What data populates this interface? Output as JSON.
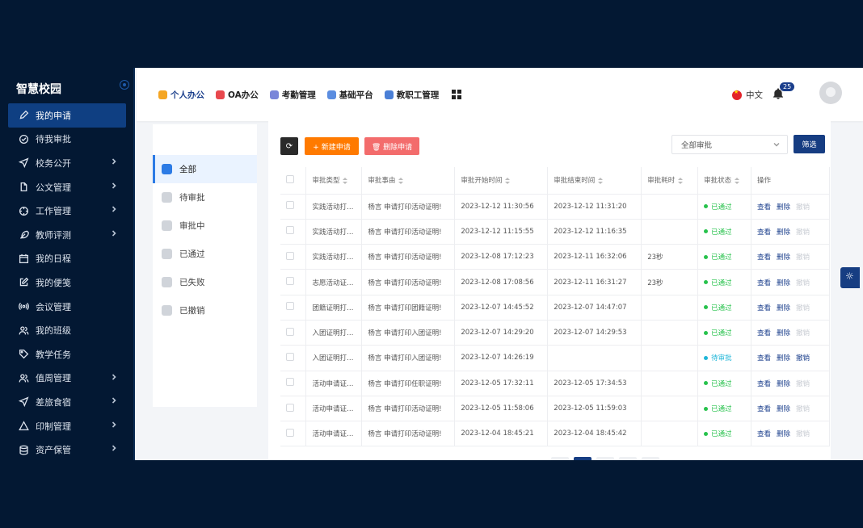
{
  "app": {
    "title": "智慧校园"
  },
  "sidebar": {
    "items": [
      {
        "label": "我的申请",
        "icon": "pen-icon",
        "active": true,
        "expandable": false
      },
      {
        "label": "待我审批",
        "icon": "check-circle-icon",
        "active": false,
        "expandable": false
      },
      {
        "label": "校务公开",
        "icon": "send-icon",
        "active": false,
        "expandable": true
      },
      {
        "label": "公文管理",
        "icon": "file-icon",
        "active": false,
        "expandable": true
      },
      {
        "label": "工作管理",
        "icon": "crosshair-icon",
        "active": false,
        "expandable": true
      },
      {
        "label": "教师评测",
        "icon": "feather-icon",
        "active": false,
        "expandable": true
      },
      {
        "label": "我的日程",
        "icon": "calendar-icon",
        "active": false,
        "expandable": false
      },
      {
        "label": "我的便笺",
        "icon": "edit-icon",
        "active": false,
        "expandable": false
      },
      {
        "label": "会议管理",
        "icon": "broadcast-icon",
        "active": false,
        "expandable": false
      },
      {
        "label": "我的班级",
        "icon": "users-icon",
        "active": false,
        "expandable": false
      },
      {
        "label": "教学任务",
        "icon": "tag-icon",
        "active": false,
        "expandable": false
      },
      {
        "label": "值周管理",
        "icon": "users-icon",
        "active": false,
        "expandable": true
      },
      {
        "label": "差旅食宿",
        "icon": "send-icon",
        "active": false,
        "expandable": true
      },
      {
        "label": "印制管理",
        "icon": "triangle-icon",
        "active": false,
        "expandable": true
      },
      {
        "label": "资产保管",
        "icon": "database-icon",
        "active": false,
        "expandable": true
      }
    ]
  },
  "topnav": {
    "items": [
      {
        "label": "个人办公",
        "color": "#f5a623",
        "active": true
      },
      {
        "label": "OA办公",
        "color": "#e8484d",
        "active": false
      },
      {
        "label": "考勤管理",
        "color": "#7a86d9",
        "active": false
      },
      {
        "label": "基础平台",
        "color": "#5b8de0",
        "active": false
      },
      {
        "label": "教职工管理",
        "color": "#4a7fd6",
        "active": false
      }
    ],
    "language": "中文",
    "notification_count": "25"
  },
  "status_tabs": {
    "items": [
      {
        "label": "全部",
        "active": true
      },
      {
        "label": "待审批",
        "active": false
      },
      {
        "label": "审批中",
        "active": false
      },
      {
        "label": "已通过",
        "active": false
      },
      {
        "label": "已失败",
        "active": false
      },
      {
        "label": "已撤销",
        "active": false
      }
    ]
  },
  "toolbar": {
    "new_label": "+ 新建申请",
    "delete_label": "🗑 删除申请",
    "filter_placeholder": "全部审批",
    "filter_button": "筛选"
  },
  "table": {
    "headers": [
      "审批类型",
      "审批事由",
      "审批开始时间",
      "审批结束时间",
      "审批耗时",
      "审批状态",
      "操作"
    ],
    "actions": {
      "view": "查看",
      "delete": "删除",
      "cancel": "撤销"
    },
    "rows": [
      {
        "type": "实践活动打…",
        "reason": "杨言 申请打印活动证明!",
        "start": "2023-12-12 11:30:56",
        "end": "2023-12-12 11:31:20",
        "duration": "",
        "status": "已通过",
        "status_color": "#27c24c",
        "cancel_enabled": false
      },
      {
        "type": "实践活动打…",
        "reason": "杨言 申请打印活动证明!",
        "start": "2023-12-12 11:15:55",
        "end": "2023-12-12 11:16:35",
        "duration": "",
        "status": "已通过",
        "status_color": "#27c24c",
        "cancel_enabled": false
      },
      {
        "type": "实践活动打…",
        "reason": "杨言 申请打印活动证明!",
        "start": "2023-12-08 17:12:23",
        "end": "2023-12-11 16:32:06",
        "duration": "23秒",
        "status": "已通过",
        "status_color": "#27c24c",
        "cancel_enabled": false
      },
      {
        "type": "志愿活动证…",
        "reason": "杨言 申请打印活动证明!",
        "start": "2023-12-08 17:08:56",
        "end": "2023-12-11 16:31:27",
        "duration": "23秒",
        "status": "已通过",
        "status_color": "#27c24c",
        "cancel_enabled": false
      },
      {
        "type": "团籍证明打…",
        "reason": "杨言 申请打印团籍证明!",
        "start": "2023-12-07 14:45:52",
        "end": "2023-12-07 14:47:07",
        "duration": "",
        "status": "已通过",
        "status_color": "#27c24c",
        "cancel_enabled": false
      },
      {
        "type": "入团证明打…",
        "reason": "杨言 申请打印入团证明!",
        "start": "2023-12-07 14:29:20",
        "end": "2023-12-07 14:29:53",
        "duration": "",
        "status": "已通过",
        "status_color": "#27c24c",
        "cancel_enabled": false
      },
      {
        "type": "入团证明打…",
        "reason": "杨言 申请打印入团证明!",
        "start": "2023-12-07 14:26:19",
        "end": "",
        "duration": "",
        "status": "待审批",
        "status_color": "#1fb6d8",
        "cancel_enabled": true
      },
      {
        "type": "活动申请证…",
        "reason": "杨言 申请打印任职证明!",
        "start": "2023-12-05 17:32:11",
        "end": "2023-12-05 17:34:53",
        "duration": "",
        "status": "已通过",
        "status_color": "#27c24c",
        "cancel_enabled": false
      },
      {
        "type": "活动申请证…",
        "reason": "杨言 申请打印活动证明!",
        "start": "2023-12-05 11:58:06",
        "end": "2023-12-05 11:59:03",
        "duration": "",
        "status": "已通过",
        "status_color": "#27c24c",
        "cancel_enabled": false
      },
      {
        "type": "活动申请证…",
        "reason": "杨言 申请打印活动证明!",
        "start": "2023-12-04 18:45:21",
        "end": "2023-12-04 18:45:42",
        "duration": "",
        "status": "已通过",
        "status_color": "#27c24c",
        "cancel_enabled": false
      }
    ]
  }
}
